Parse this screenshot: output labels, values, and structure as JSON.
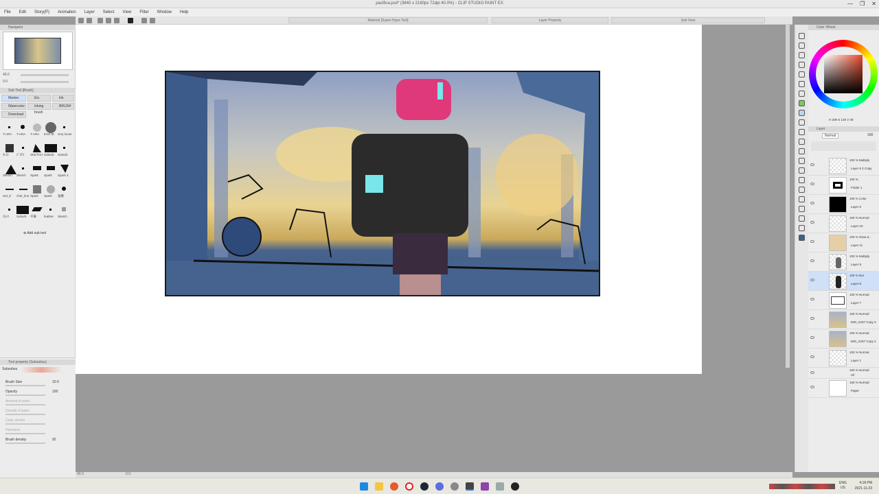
{
  "window": {
    "title": "pacifica.psd* (3840 x 2160px 72dpi 40.0%) - CLIP STUDIO PAINT EX",
    "controls": [
      "—",
      "❐",
      "✕"
    ]
  },
  "menu": [
    "File",
    "Edit",
    "Story(P)",
    "Animation",
    "Layer",
    "Select",
    "View",
    "Filter",
    "Window",
    "Help"
  ],
  "tabs": {
    "material": "Material [Super-Hype Tool]",
    "layer_property": "Layer Property",
    "sub_view": "Sub View"
  },
  "navigator": {
    "header": "Navigator",
    "zoom": "40.0",
    "rotation": "0.0"
  },
  "subtool": {
    "header": "Sub Tool [Brush]",
    "tabs": [
      "Marker",
      "Etc.",
      "Ink",
      "Watercolor",
      "Inking brush",
      "BRUSH",
      "Download"
    ],
    "brushes": [
      {
        "label": "T-ARA"
      },
      {
        "label": "T-ARA"
      },
      {
        "label": "T-ARA"
      },
      {
        "label": "EXO M"
      },
      {
        "label": "very loose"
      },
      {
        "label": "ｸﾚﾖﾝ"
      },
      {
        "label": "ﾊﾟｽﾃﾙ"
      },
      {
        "label": "SKETCH"
      },
      {
        "label": "Suburb"
      },
      {
        "label": "Suburb"
      },
      {
        "label": "Sketch"
      },
      {
        "label": "Sketch"
      },
      {
        "label": "Spark"
      },
      {
        "label": "Spark"
      },
      {
        "label": "Spark 3"
      },
      {
        "label": "wet_b"
      },
      {
        "label": "char_line"
      },
      {
        "label": "Spark"
      },
      {
        "label": "Spark"
      },
      {
        "label": "油墨"
      },
      {
        "label": "ｽﾓｯｸ"
      },
      {
        "label": "Suburb"
      },
      {
        "label": "千筆"
      },
      {
        "label": "feather"
      },
      {
        "label": "Sketch"
      }
    ],
    "add_label": "Add sub tool"
  },
  "tool_property": {
    "header": "Tool property (Subsubsu)",
    "brush_name": "Subsubsu",
    "rows": [
      {
        "label": "Brush Size",
        "value": "10.0",
        "enabled": true
      },
      {
        "label": "Opacity",
        "value": "100",
        "enabled": true
      },
      {
        "label": "Amount of paint",
        "value": "",
        "enabled": false
      },
      {
        "label": "Density of paint",
        "value": "",
        "enabled": false
      },
      {
        "label": "Color stretch",
        "value": "",
        "enabled": false
      },
      {
        "label": "Hardness",
        "value": "",
        "enabled": false
      },
      {
        "label": "Brush density",
        "value": "92",
        "enabled": true
      }
    ]
  },
  "color_panel": {
    "header": "Color Wheel",
    "values": "H 209  S 126  V 39"
  },
  "layers": {
    "header": "Layer",
    "blend": "Normal",
    "opacity": "100",
    "items": [
      {
        "mode": "100 % Multiply",
        "name": "Layer 6 2 Copy"
      },
      {
        "mode": "100 %",
        "name": "Folder 1"
      },
      {
        "mode": "100 % Color",
        "name": "Layer 6"
      },
      {
        "mode": "100 % Normal",
        "name": "Layer 10"
      },
      {
        "mode": "100 % Glow d...",
        "name": "Layer 11"
      },
      {
        "mode": "100 % Multiply",
        "name": "Layer 9"
      },
      {
        "mode": "100 % Nor",
        "name": "Layer 8",
        "selected": true
      },
      {
        "mode": "100 % Normal",
        "name": "Layer 7"
      },
      {
        "mode": "100 % Normal",
        "name": "IMG_0437 Copy 3"
      },
      {
        "mode": "100 % Normal",
        "name": "IMG_0437 Copy 2"
      },
      {
        "mode": "100 % Normal",
        "name": "Layer 1"
      },
      {
        "mode": "100 % Normal",
        "name": "ref"
      },
      {
        "mode": "100 % Normal",
        "name": "Paper"
      }
    ]
  },
  "status": {
    "zoom": "40.0",
    "angle": "0.0"
  },
  "taskbar": {
    "lang": "ENG",
    "region": "US",
    "time": "4:18 PM",
    "date": "2021-11-23"
  },
  "colors": {
    "accent": "#cfe0f7",
    "panel": "#ececec",
    "canvas_bg": "#9a9a9a"
  }
}
